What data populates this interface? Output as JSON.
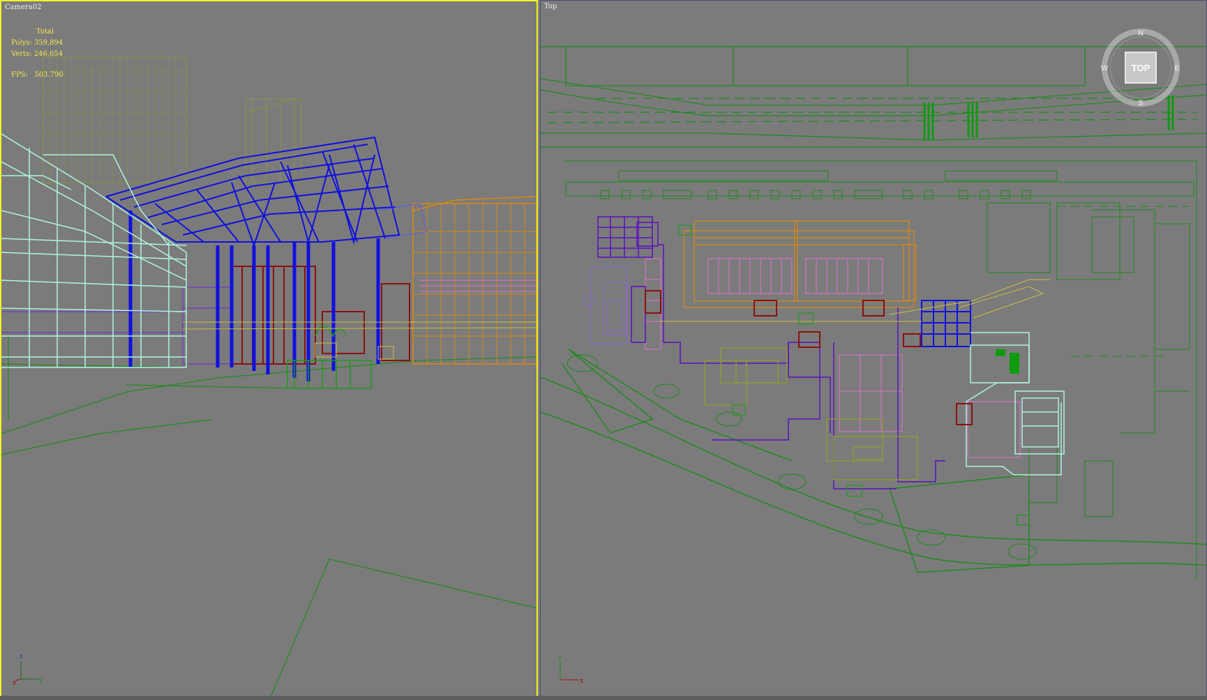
{
  "viewports": {
    "left": {
      "label": "Camera02",
      "stats": {
        "total_label": "Total",
        "polys_label": "Polys:",
        "polys_value": "359,894",
        "verts_label": "Verts:",
        "verts_value": "246,654",
        "fps_label": "FPS:",
        "fps_value": "503.790"
      },
      "axis": {
        "z": "z",
        "x": "x",
        "y": "y"
      }
    },
    "right": {
      "label": "Top",
      "viewcube": {
        "face": "TOP",
        "n": "N",
        "w": "W",
        "e": "E",
        "s": "S"
      },
      "axis": {
        "y": "y",
        "x": "x"
      }
    }
  },
  "colors": {
    "active_border": "#f3f32a",
    "viewport_bg": "#7b7b7b",
    "stats_text": "#f2e84a",
    "wire_green": "#1f8a1f",
    "wire_blue": "#1010e0",
    "wire_orange": "#d98a10",
    "wire_cyan": "#aef5e0",
    "wire_red": "#8a1010",
    "wire_magenta": "#e070d0",
    "wire_purple": "#5a10c0",
    "wire_olive": "#8a9a3a"
  }
}
